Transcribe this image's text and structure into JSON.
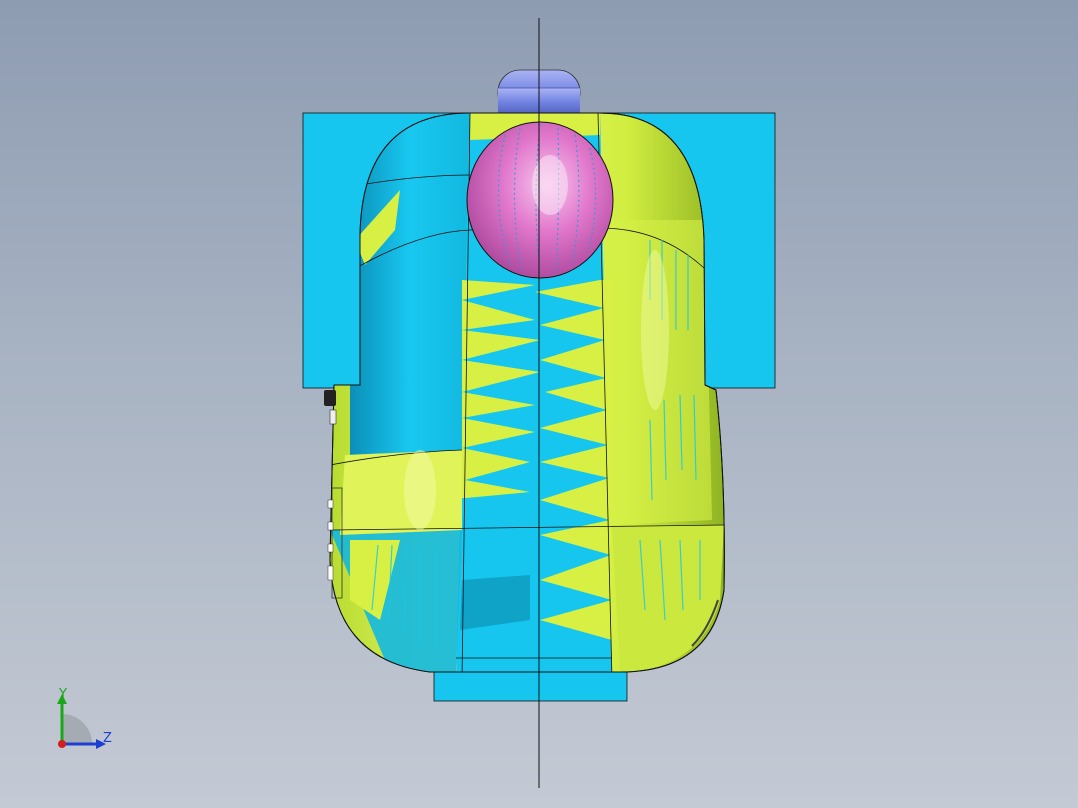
{
  "viewport": {
    "background_top": "#8e9cb2",
    "background_bottom": "#c4cad4"
  },
  "model": {
    "colors": {
      "cyan": "#16c6ee",
      "cyan_shade": "#0fa3c8",
      "yellow_green": "#d8f044",
      "yellow_green_shade": "#9cc22a",
      "magenta": "#e070c8",
      "blue_cap": "#7080e0",
      "edge": "#111111"
    }
  },
  "triad": {
    "y_label": "Y",
    "z_label": "Z",
    "colors": {
      "y": "#1aa81a",
      "z": "#1d3fd1",
      "x": "#d02020"
    }
  }
}
